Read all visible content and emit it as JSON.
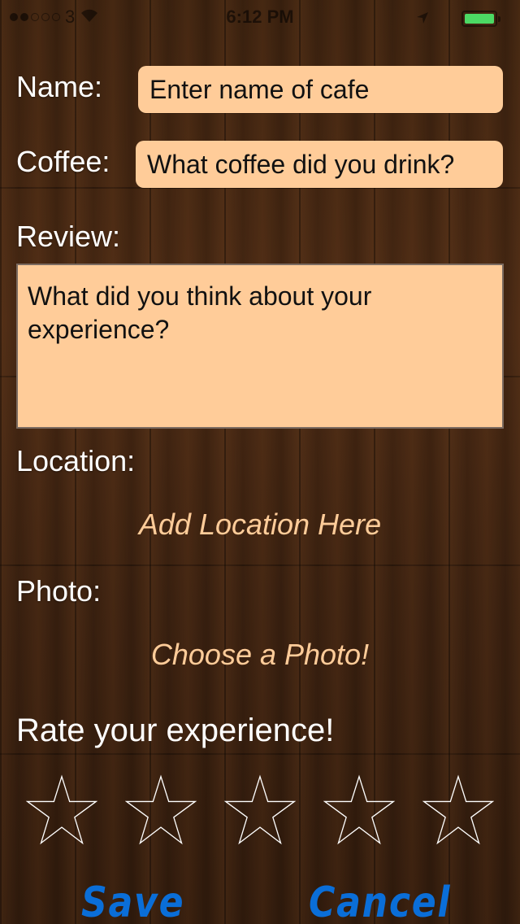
{
  "status_bar": {
    "carrier": "3",
    "time": "6:12 PM"
  },
  "form": {
    "name_label": "Name:",
    "name_placeholder": "Enter name of cafe",
    "coffee_label": "Coffee:",
    "coffee_placeholder": "What coffee did you drink?",
    "review_label": "Review:",
    "review_placeholder": "What did you think about your experience?",
    "location_label": "Location:",
    "location_button": "Add Location Here",
    "photo_label": "Photo:",
    "photo_button": "Choose a Photo!",
    "rating_label": "Rate your experience!",
    "rating_value": 0,
    "rating_max": 5
  },
  "actions": {
    "save": "Save",
    "cancel": "Cancel"
  },
  "colors": {
    "field_bg": "#ffcc99",
    "link": "#ffcc99",
    "button": "#0a6ed8",
    "battery": "#4cd964"
  }
}
